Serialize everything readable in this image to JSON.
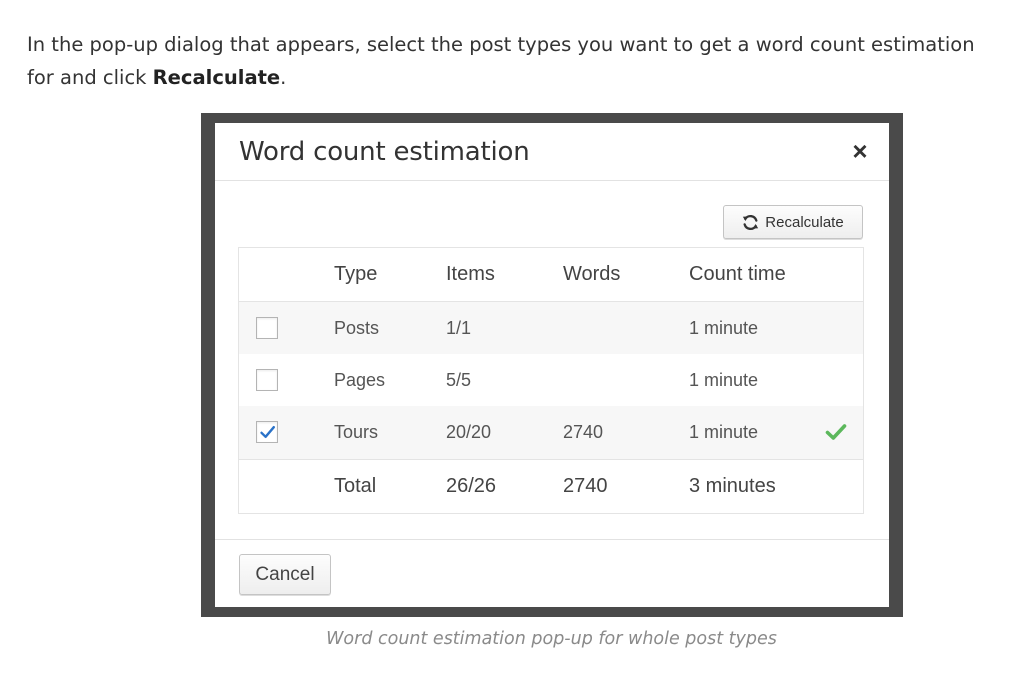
{
  "intro": {
    "text_before": "In the pop-up dialog that appears, select the post types you want to get a word count estimation for and click ",
    "bold": "Recalculate",
    "text_after": "."
  },
  "dialog": {
    "title": "Word count estimation",
    "close_label": "×",
    "recalculate_label": "Recalculate",
    "cancel_label": "Cancel"
  },
  "table": {
    "headers": {
      "type": "Type",
      "items": "Items",
      "words": "Words",
      "count_time": "Count time"
    },
    "rows": [
      {
        "type": "Posts",
        "items": "1/1",
        "words": "",
        "count_time": "1 minute",
        "checked": false,
        "done": false
      },
      {
        "type": "Pages",
        "items": "5/5",
        "words": "",
        "count_time": "1 minute",
        "checked": false,
        "done": false
      },
      {
        "type": "Tours",
        "items": "20/20",
        "words": "2740",
        "count_time": "1 minute",
        "checked": true,
        "done": true
      }
    ],
    "total": {
      "type": "Total",
      "items": "26/26",
      "words": "2740",
      "count_time": "3 minutes"
    }
  },
  "caption": "Word count estimation pop-up for whole post types",
  "colors": {
    "check_blue": "#2a72c8",
    "success_green": "#5cb85c",
    "frame": "#4a4a4a"
  },
  "icons": {
    "refresh": "refresh-icon",
    "close": "close-icon",
    "check": "checkmark-icon",
    "success": "success-check-icon"
  }
}
